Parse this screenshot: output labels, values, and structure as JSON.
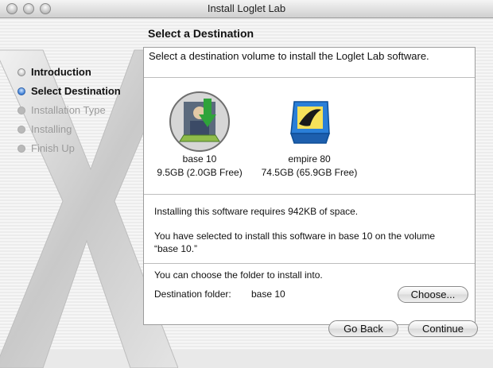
{
  "window": {
    "title": "Install Loglet Lab"
  },
  "sidebar": {
    "steps": [
      {
        "label": "Introduction",
        "state": "done"
      },
      {
        "label": "Select Destination",
        "state": "current"
      },
      {
        "label": "Installation Type",
        "state": "future"
      },
      {
        "label": "Installing",
        "state": "future"
      },
      {
        "label": "Finish Up",
        "state": "future"
      }
    ]
  },
  "main": {
    "heading": "Select a Destination",
    "intro": "Select a destination volume to install the Loglet Lab software.",
    "volumes": [
      {
        "name": "base 10",
        "size": "9.5GB (2.0GB Free)",
        "selected": true,
        "icon": "hard-drive-photo-icon"
      },
      {
        "name": "empire 80",
        "size": "74.5GB (65.9GB Free)",
        "selected": false,
        "icon": "hard-drive-banana-icon"
      }
    ],
    "requirement": "Installing this software requires 942KB of space.",
    "selection": "You have selected to install this software in base 10  on the volume “base 10.”",
    "choose_hint": "You can choose the folder to install into.",
    "destination_label": "Destination folder:",
    "destination_value": "base 10",
    "choose_button": "Choose..."
  },
  "footer": {
    "back": "Go Back",
    "continue": "Continue"
  },
  "colors": {
    "accent": "#3d7fd6",
    "disabled": "#9b9b9b",
    "install_arrow": "#2fa33a"
  }
}
